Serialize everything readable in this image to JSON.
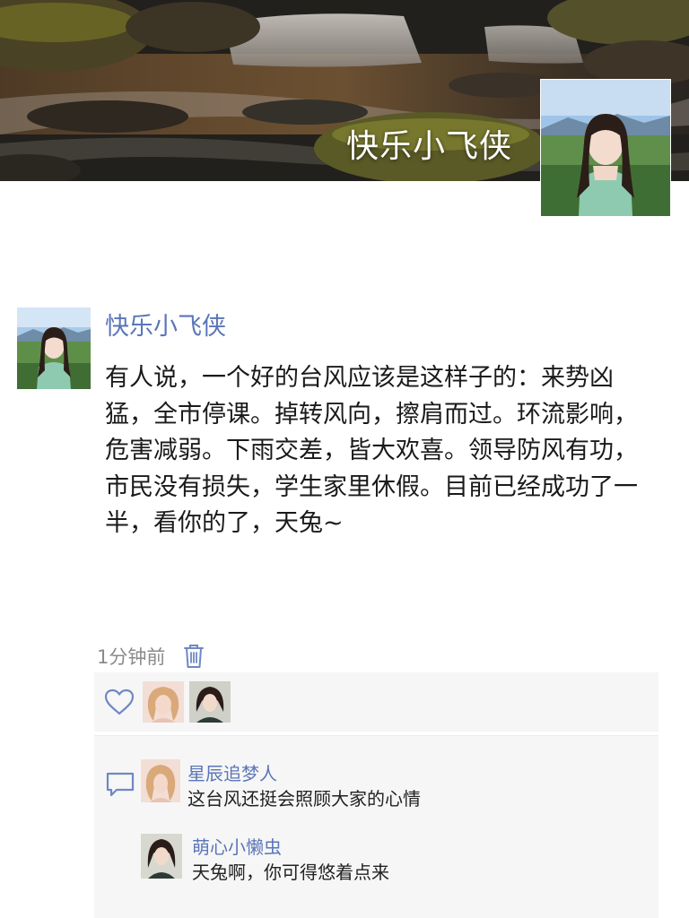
{
  "cover": {
    "name": "快乐小飞侠"
  },
  "post": {
    "author": "快乐小飞侠",
    "text": "有人说，一个好的台风应该是这样子的：来势凶猛，全市停课。掉转风向，擦肩而过。环流影响，危害减弱。下雨交差，皆大欢喜。领导防风有功，市民没有损失，学生家里休假。目前已经成功了一半，看你的了，天兔~",
    "time": "1分钟前",
    "delete_icon": "trash-icon"
  },
  "likes": {
    "icon": "heart-icon"
  },
  "comments": {
    "icon": "comment-bubble-icon",
    "items": [
      {
        "name": "星辰追梦人",
        "text": "这台风还挺会照顾大家的心情"
      },
      {
        "name": "萌心小懒虫",
        "text": "天兔啊，你可得悠着点来"
      }
    ]
  },
  "colors": {
    "link": "#5a76b8",
    "text": "#1a1a1a",
    "muted": "#8a8a8a",
    "panel": "#f6f6f6"
  }
}
